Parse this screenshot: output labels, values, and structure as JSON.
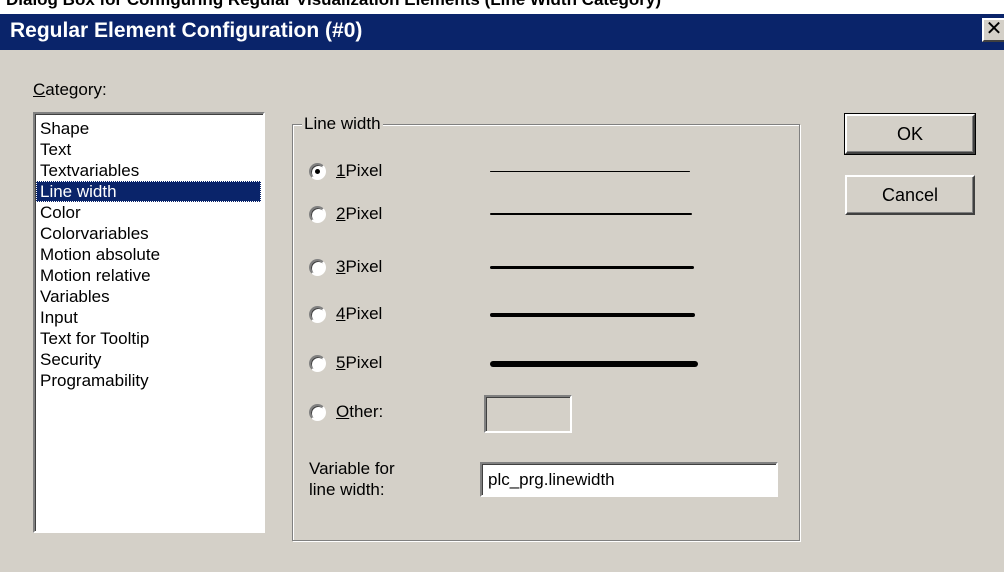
{
  "caption_strip": "Dialog Box for Configuring Regular Visualization Elements (Line Width Category)",
  "window": {
    "title": "Regular Element Configuration (#0)",
    "close_glyph": "✕"
  },
  "category": {
    "label_mnemonic": "C",
    "label_rest": "ategory:",
    "items": [
      "Shape",
      "Text",
      "Textvariables",
      "Line width",
      "Color",
      "Colorvariables",
      "Motion absolute",
      "Motion relative",
      "Variables",
      "Input",
      "Text for Tooltip",
      "Security",
      "Programability"
    ],
    "selected": "Line width"
  },
  "line_width": {
    "group_title": "Line width",
    "options": [
      {
        "mnemonic": "1",
        "rest": " Pixel",
        "checked": true
      },
      {
        "mnemonic": "2",
        "rest": " Pixel",
        "checked": false
      },
      {
        "mnemonic": "3",
        "rest": " Pixel",
        "checked": false
      },
      {
        "mnemonic": "4",
        "rest": " Pixel",
        "checked": false
      },
      {
        "mnemonic": "5",
        "rest": " Pixel",
        "checked": false
      },
      {
        "mnemonic": "O",
        "rest": "ther:",
        "checked": false
      }
    ],
    "other_value": "",
    "variable_label_line1": "Variable for",
    "variable_label_line2": "line width:",
    "variable_value": "plc_prg.linewidth"
  },
  "buttons": {
    "ok": "OK",
    "cancel": "Cancel"
  }
}
